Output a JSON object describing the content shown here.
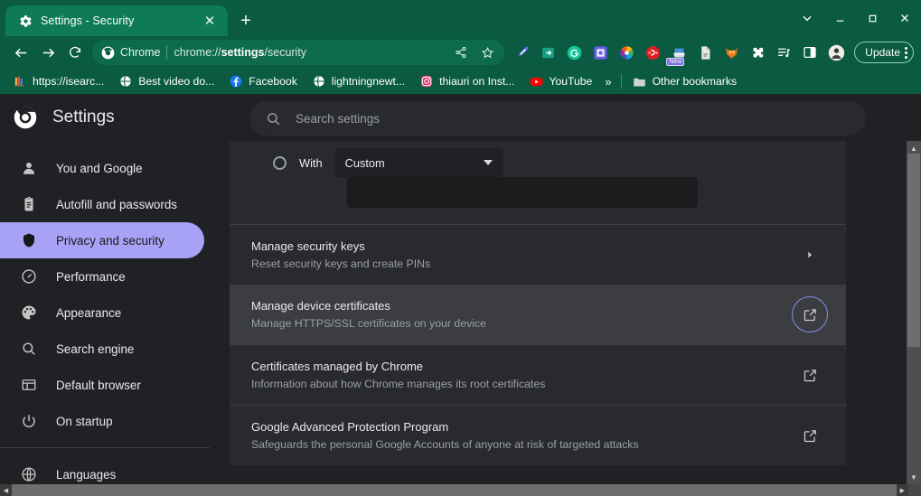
{
  "window": {
    "controls": {
      "chevron_label": "chevron-down",
      "minimize_label": "–",
      "maximize_label": "□",
      "close_label": "✕"
    }
  },
  "tabstrip": {
    "tabs": [
      {
        "title": "Settings - Security",
        "favicon": "gear-icon",
        "close_label": "✕"
      }
    ],
    "new_tab_label": "+"
  },
  "toolbar": {
    "back_label": "←",
    "forward_label": "→",
    "reload_label": "⟳",
    "omnibox": {
      "chip_label": "Chrome",
      "url_prefix": "chrome://",
      "url_bold": "settings",
      "url_suffix": "/security",
      "full_url": "chrome://settings/security",
      "share_icon": "share-icon",
      "bookmark_icon": "star-icon"
    },
    "extensions": [
      {
        "name": "eyedropper-extension",
        "icon": "eyedropper-icon"
      },
      {
        "name": "save-page-extension",
        "icon": "save-arrow-icon"
      },
      {
        "name": "grammarly-extension",
        "icon": "grammarly-g-icon"
      },
      {
        "name": "screenshot-extension",
        "icon": "screenshot-icon"
      },
      {
        "name": "color-wheel-extension",
        "icon": "color-wheel-icon"
      },
      {
        "name": "adblock-extension",
        "icon": "adblock-icon"
      },
      {
        "name": "scanner-extension",
        "icon": "scanner-icon",
        "badge": "New"
      },
      {
        "name": "document-extension",
        "icon": "document-icon"
      },
      {
        "name": "metamask-extension",
        "icon": "fox-icon"
      },
      {
        "name": "extensions-menu",
        "icon": "puzzle-icon"
      },
      {
        "name": "reading-list",
        "icon": "playlist-icon"
      },
      {
        "name": "side-panel",
        "icon": "side-panel-icon"
      },
      {
        "name": "profile-avatar",
        "icon": "avatar-icon"
      }
    ],
    "update_label": "Update",
    "menu_label": "chrome-menu"
  },
  "bookmarks": {
    "items": [
      {
        "label": "https://isearc...",
        "icon": "books-icon"
      },
      {
        "label": "Best video do...",
        "icon": "globe-icon"
      },
      {
        "label": "Facebook",
        "icon": "facebook-icon"
      },
      {
        "label": "lightningnewt...",
        "icon": "globe-icon"
      },
      {
        "label": "thiauri on Inst...",
        "icon": "instagram-icon"
      },
      {
        "label": "YouTube",
        "icon": "youtube-icon"
      }
    ],
    "overflow_label": "»",
    "other_bookmarks": {
      "label": "Other bookmarks",
      "icon": "folder-icon"
    }
  },
  "settings": {
    "title": "Settings",
    "logo": "chrome-logo-icon",
    "search": {
      "placeholder": "Search settings",
      "icon": "search-icon",
      "value": ""
    },
    "nav": [
      {
        "label": "You and Google",
        "icon": "person-icon",
        "selected": false
      },
      {
        "label": "Autofill and passwords",
        "icon": "clipboard-icon",
        "selected": false
      },
      {
        "label": "Privacy and security",
        "icon": "shield-icon",
        "selected": true
      },
      {
        "label": "Performance",
        "icon": "speedometer-icon",
        "selected": false
      },
      {
        "label": "Appearance",
        "icon": "palette-icon",
        "selected": false
      },
      {
        "label": "Search engine",
        "icon": "search-icon",
        "selected": false
      },
      {
        "label": "Default browser",
        "icon": "browser-window-icon",
        "selected": false
      },
      {
        "label": "On startup",
        "icon": "power-icon",
        "selected": false
      },
      {
        "label": "Languages",
        "icon": "globe-icon",
        "selected": false
      }
    ],
    "selected_accent": "#a8a2f7",
    "radio_option": {
      "label": "With",
      "select_value": "Custom",
      "caret": "chevron-down-icon",
      "textbox_value": ""
    },
    "rows": [
      {
        "title": "Manage security keys",
        "subtitle": "Reset security keys and create PINs",
        "action": "chevron-right-icon",
        "hovered": false,
        "focused": false
      },
      {
        "title": "Manage device certificates",
        "subtitle": "Manage HTTPS/SSL certificates on your device",
        "action": "external-link-icon",
        "hovered": true,
        "focused": true
      },
      {
        "title": "Certificates managed by Chrome",
        "subtitle": "Information about how Chrome manages its root certificates",
        "action": "external-link-icon",
        "hovered": false,
        "focused": false
      },
      {
        "title": "Google Advanced Protection Program",
        "subtitle": "Safeguards the personal Google Accounts of anyone at risk of targeted attacks",
        "action": "external-link-icon",
        "hovered": false,
        "focused": false
      }
    ]
  }
}
